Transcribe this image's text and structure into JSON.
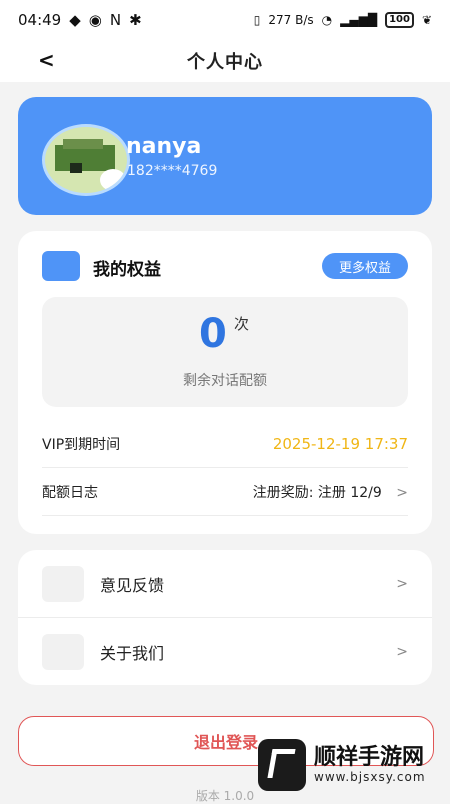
{
  "status": {
    "time": "04:49",
    "net_speed": "277\nB/s",
    "battery": "100"
  },
  "nav": {
    "back": "<",
    "title": "个人中心"
  },
  "profile": {
    "name": "nanya",
    "phone": "182****4769"
  },
  "rights": {
    "title": "我的权益",
    "more": "更多权益",
    "count": "0",
    "unit": "次",
    "count_label": "剩余对话配额",
    "vip_label": "VIP到期时间",
    "vip_value": "2025-12-19 17:37",
    "log_label": "配额日志",
    "log_value": "注册奖励: 注册 12/9",
    "chev": ">"
  },
  "menu": {
    "feedback": "意见反馈",
    "about": "关于我们",
    "chev": ">"
  },
  "logout": "退出登录",
  "version": "版本 1.0.0",
  "watermark": {
    "main": "顺祥手游网",
    "sub": "www.bjsxsy.com"
  },
  "colors": {
    "primary": "#4f94f7",
    "vip": "#f0b616",
    "danger": "#e05656"
  }
}
